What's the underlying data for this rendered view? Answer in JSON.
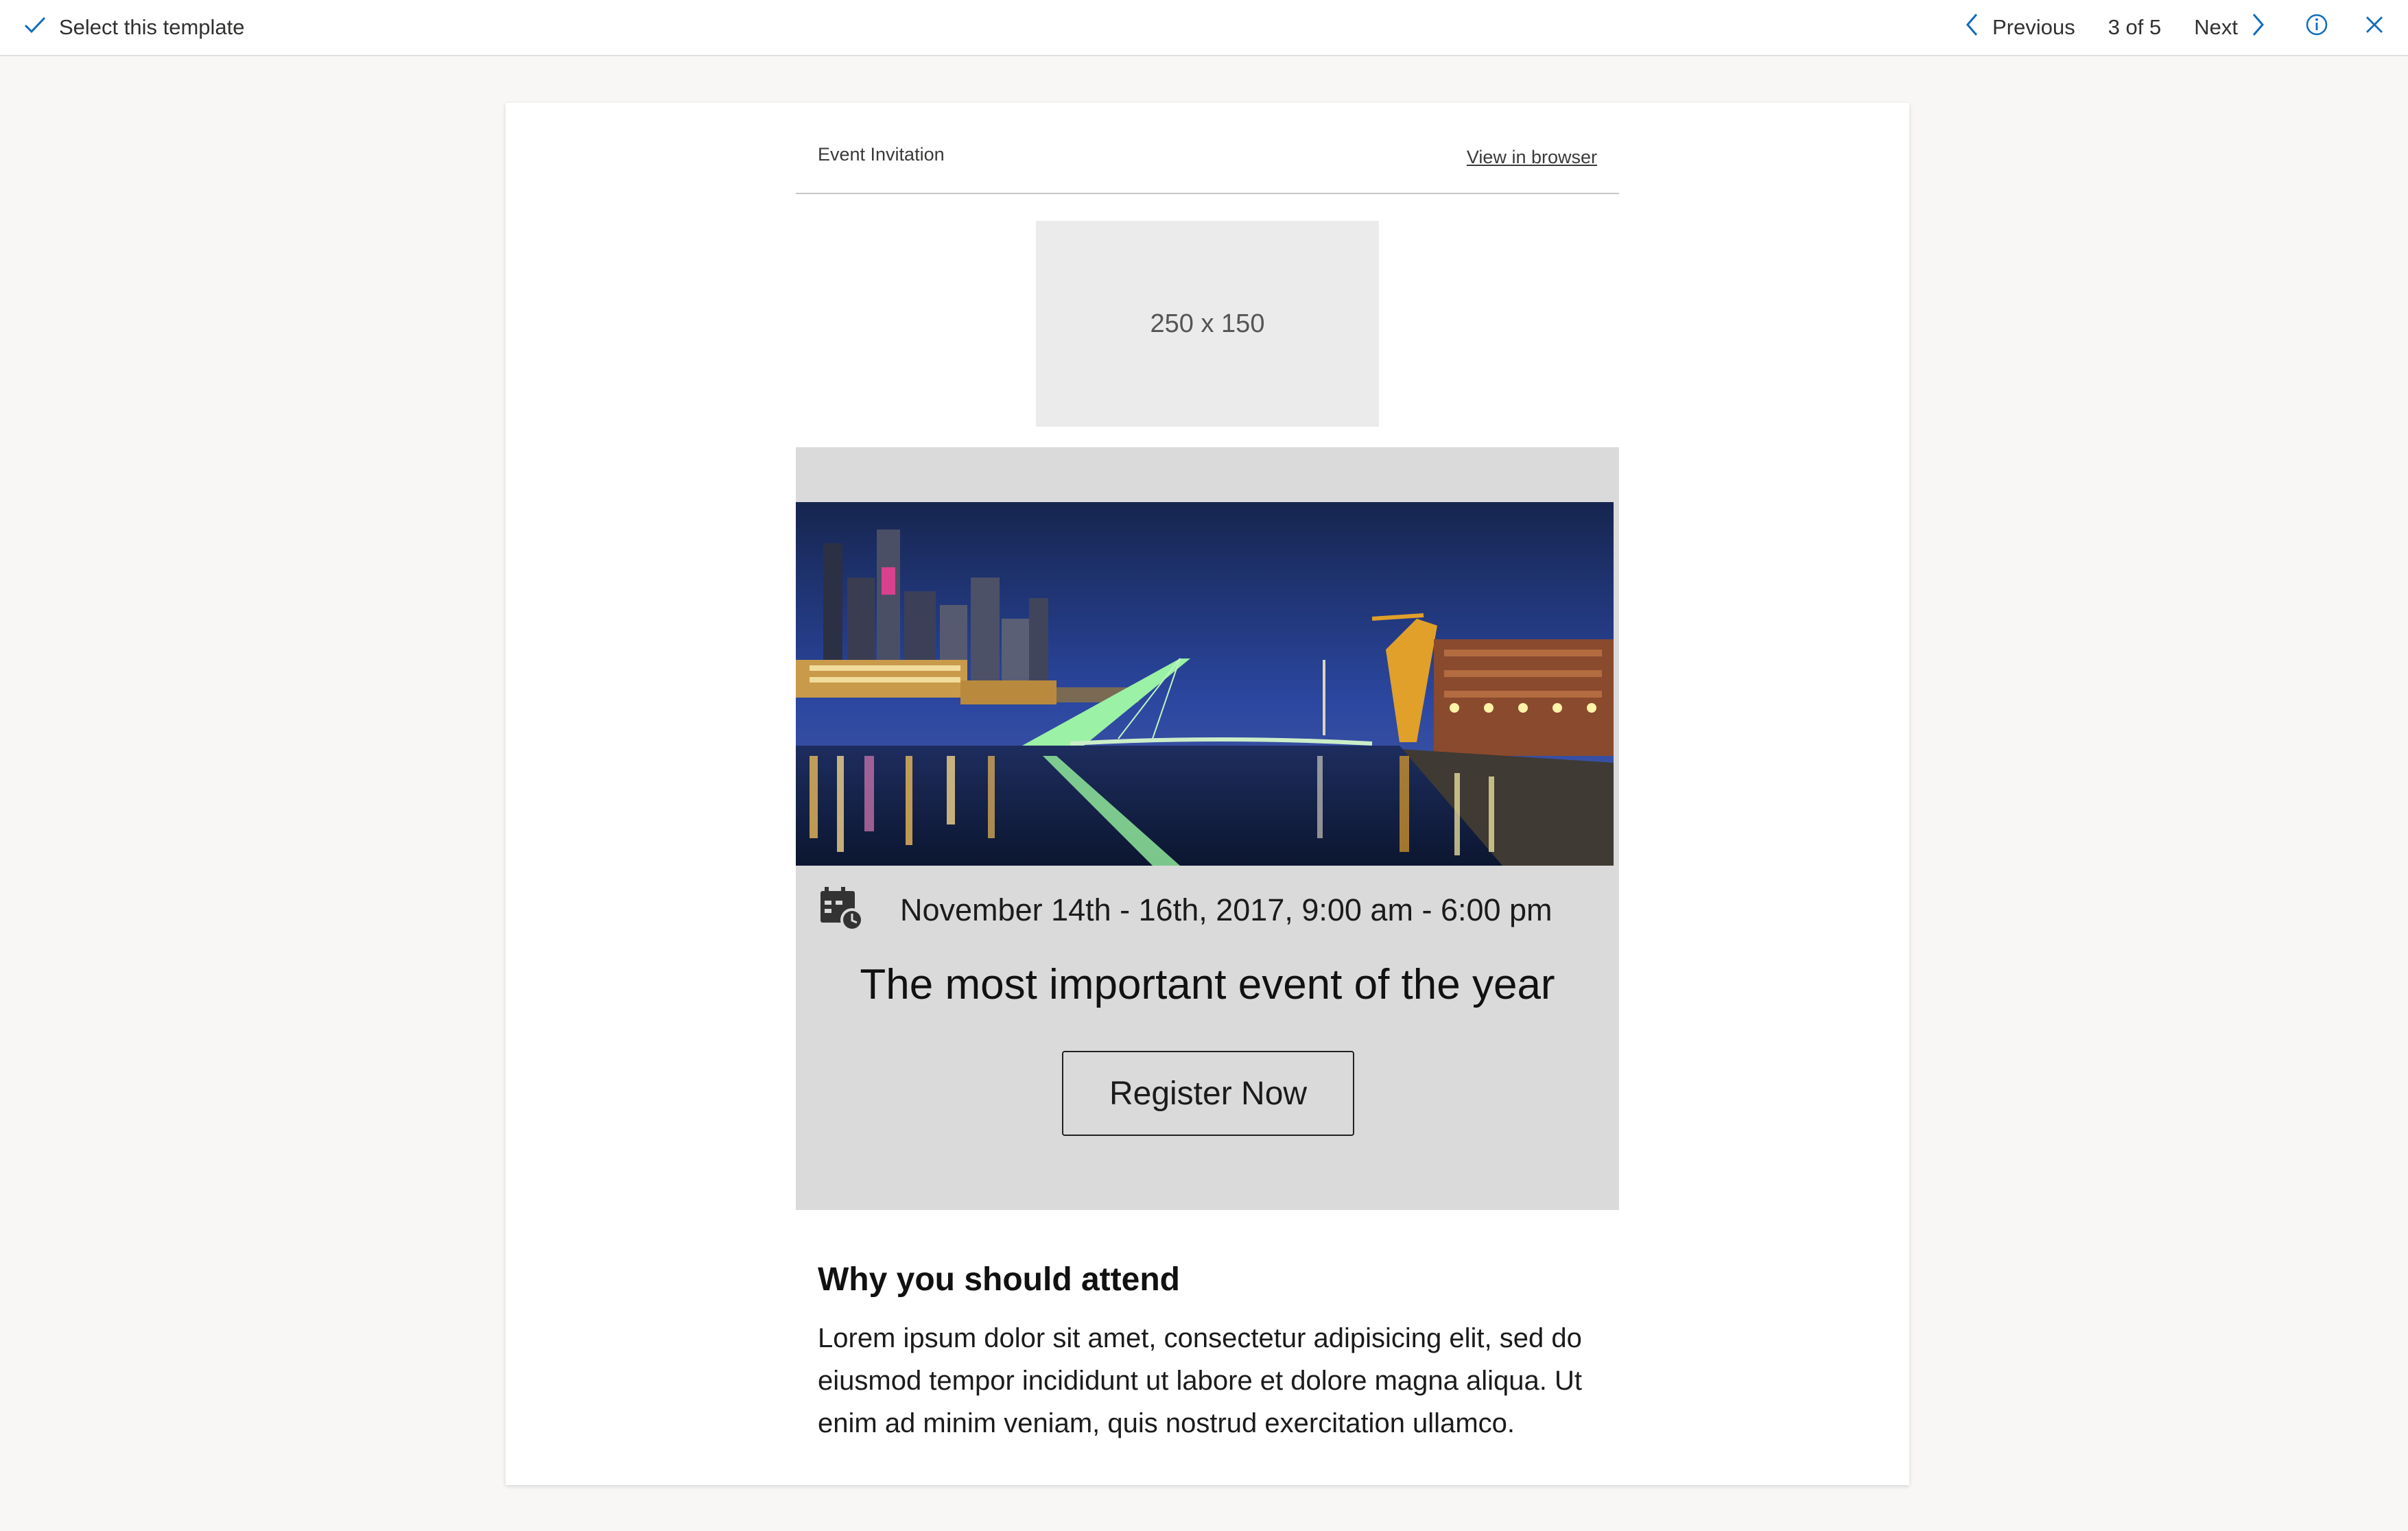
{
  "toolbar": {
    "select_label": "Select this template",
    "previous_label": "Previous",
    "counter": "3 of 5",
    "next_label": "Next",
    "icons": [
      "checkmark-icon",
      "chevron-left-icon",
      "chevron-right-icon",
      "info-icon",
      "close-icon"
    ]
  },
  "email": {
    "header_label": "Event Invitation",
    "view_in_browser": "View in browser",
    "logo_placeholder": "250 x 150",
    "date_text": "November 14th - 16th, 2017, 9:00 am - 6:00 pm",
    "headline": "The most important event of the year",
    "register_label": "Register Now",
    "why_title": "Why you should attend",
    "why_body": "Lorem ipsum dolor sit amet, consectetur adipisicing elit, sed do eiusmod tempor incididunt ut labore et dolore magna aliqua. Ut enim ad minim veniam, quis nostrud exercitation ullamco."
  },
  "colors": {
    "accent": "#0f6cbd",
    "page_background": "#f8f7f6",
    "hero_panel": "#dadada",
    "placeholder": "#ebebeb"
  }
}
